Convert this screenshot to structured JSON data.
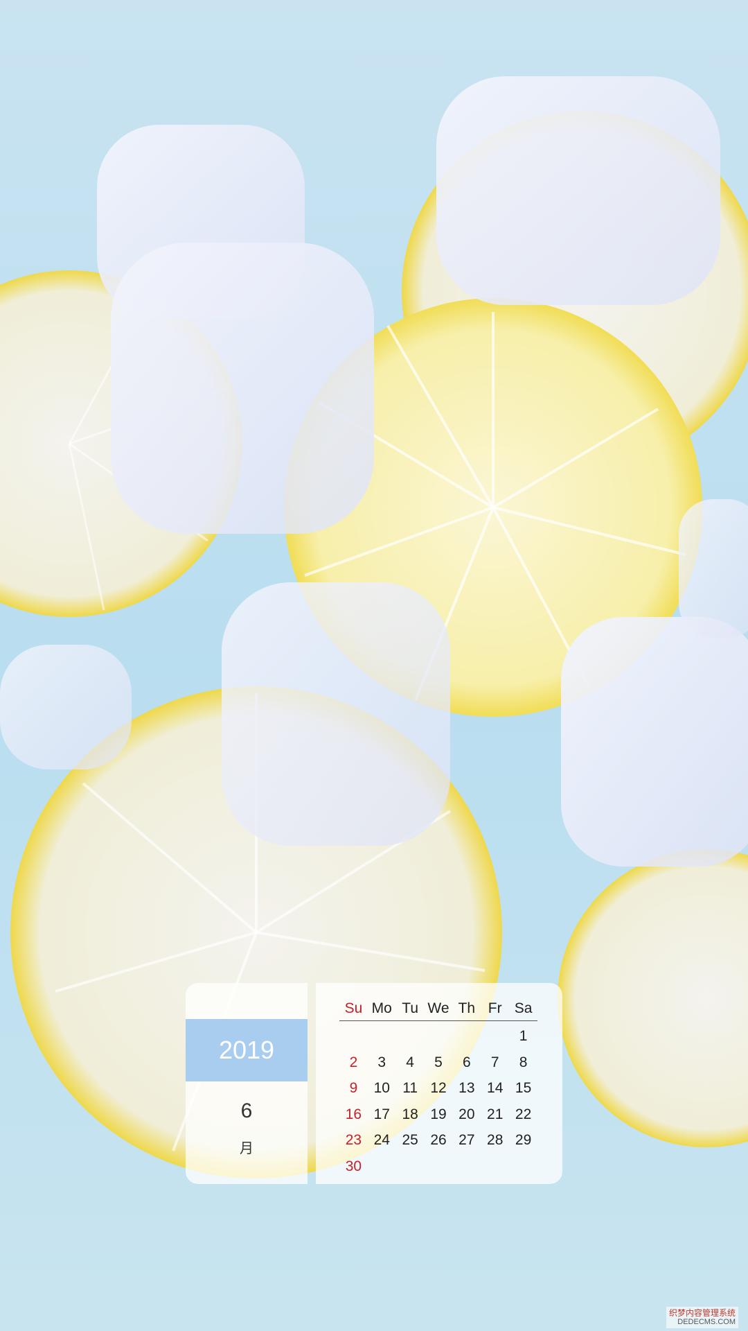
{
  "calendar": {
    "year": "2019",
    "month": "6",
    "month_char": "月",
    "weekdays": [
      "Su",
      "Mo",
      "Tu",
      "We",
      "Th",
      "Fr",
      "Sa"
    ],
    "first_weekday_index": 6,
    "days": [
      "1",
      "2",
      "3",
      "4",
      "5",
      "6",
      "7",
      "8",
      "9",
      "10",
      "11",
      "12",
      "13",
      "14",
      "15",
      "16",
      "17",
      "18",
      "19",
      "20",
      "21",
      "22",
      "23",
      "24",
      "25",
      "26",
      "27",
      "28",
      "29",
      "30"
    ],
    "sunday_color": "#c8202a",
    "weekday_color": "#222222",
    "accent_band_color": "#a9cdef"
  },
  "background": {
    "description_icon": "lemon-slices-ice-photo-icon",
    "colors": {
      "water": "#bfe0ec",
      "lemon_rind": "#f3e36a",
      "lemon_flesh": "#fbf6c8",
      "ice": "#eef2fb"
    }
  },
  "watermark": {
    "line1": "织梦内容管理系统",
    "line2": "DEDECMS.COM"
  }
}
